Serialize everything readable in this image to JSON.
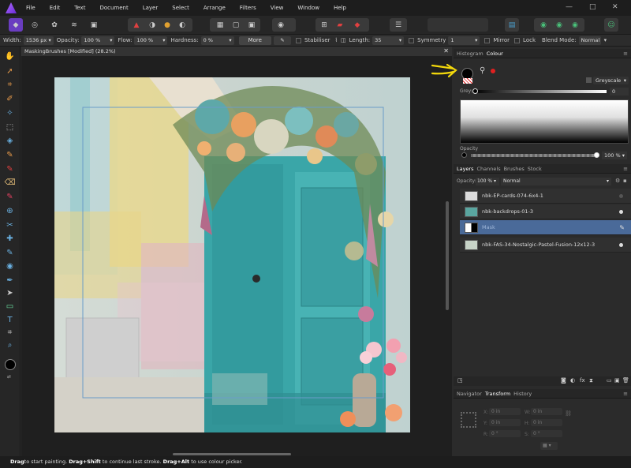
{
  "menu": [
    "File",
    "Edit",
    "Text",
    "Document",
    "Layer",
    "Select",
    "Arrange",
    "Filters",
    "View",
    "Window",
    "Help"
  ],
  "window_controls": {
    "minimize": "—",
    "maximize": "□",
    "close": "✕"
  },
  "context": {
    "width_label": "Width:",
    "width_value": "1536 px",
    "opacity_label": "Opacity:",
    "opacity_value": "100 %",
    "flow_label": "Flow:",
    "flow_value": "100 %",
    "hardness_label": "Hardness:",
    "hardness_value": "0 %",
    "more_label": "More",
    "stabiliser_label": "Stabiliser",
    "length_label": "Length:",
    "length_value": "35",
    "symmetry_label": "Symmetry",
    "symmetry_value": "1",
    "mirror_label": "Mirror",
    "lock_label": "Lock",
    "blend_label": "Blend Mode:",
    "blend_value": "Normal"
  },
  "document": {
    "tab_title": "MaskingBrushes [Modified] (28.2%)",
    "close": "✕"
  },
  "colour_panel": {
    "tabs": [
      "Histogram",
      "Colour"
    ],
    "mode": "Greyscale",
    "grey_label": "Grey:",
    "grey_value": "0",
    "opacity_label": "Opacity",
    "opacity_value": "100 %"
  },
  "layers_panel": {
    "tabs": [
      "Layers",
      "Channels",
      "Brushes",
      "Stock"
    ],
    "opacity_label": "Opacity:",
    "opacity_value": "100 %",
    "blend_value": "Normal",
    "layers": [
      {
        "name": "nbk-EP-cards-074-6x4-1",
        "selected": false
      },
      {
        "name": "nbk-backdrops-01-3",
        "selected": false
      },
      {
        "name": "Mask",
        "selected": true
      },
      {
        "name": "nbk-FAS-34-Nostalgic-Pastel-Fusion-12x12-3",
        "selected": false
      }
    ]
  },
  "transform_panel": {
    "tabs": [
      "Navigator",
      "Transform",
      "History"
    ],
    "x_label": "X:",
    "x_value": "0 in",
    "y_label": "Y:",
    "y_value": "0 in",
    "w_label": "W:",
    "w_value": "0 in",
    "h_label": "H:",
    "h_value": "0 in",
    "r_label": "R:",
    "r_value": "0 °",
    "s_label": "S:",
    "s_value": "0 °"
  },
  "status": {
    "p1": "to start painting. ",
    "p2": " to continue last stroke. ",
    "p3": " to use colour picker.",
    "k1": "Drag",
    "k2": "Drag+Shift",
    "k3": "Drag+Alt"
  },
  "colors": {
    "accent": "#4a6a99",
    "selected_row": "#4a6a99",
    "annotation": "#f2d70c",
    "teal_door": "#3aa6a8",
    "red_swatch": "#e02020"
  }
}
